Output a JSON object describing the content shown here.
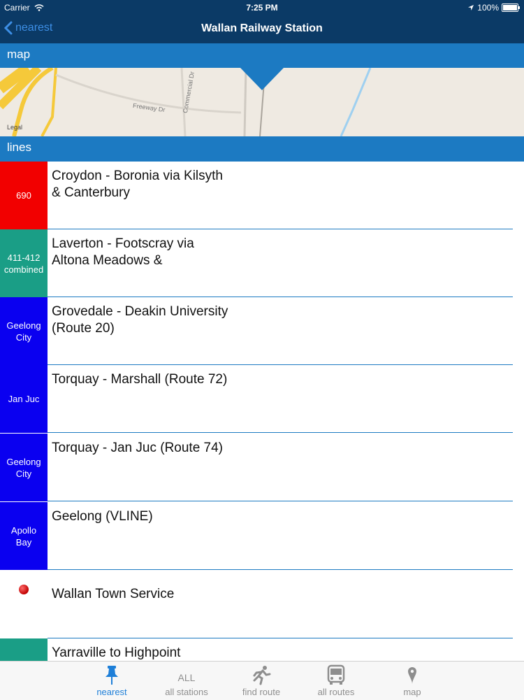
{
  "status": {
    "carrier": "Carrier",
    "time": "7:25 PM",
    "battery": "100%",
    "battery_level": 1.0
  },
  "nav": {
    "back_label": "nearest",
    "title": "Wallan Railway Station"
  },
  "sections": {
    "map": "map",
    "lines": "lines"
  },
  "map": {
    "labels": [
      "Freeway Dr",
      "Commercial Dr",
      "Legal"
    ]
  },
  "lines": [
    {
      "badge": "690",
      "name": "Croydon - Boronia via Kilsyth & Canterbury",
      "color": "#f20000"
    },
    {
      "badge": "411-412 combined",
      "name": "Laverton - Footscray via Altona Meadows &",
      "color": "#1a9e86"
    },
    {
      "badge": "Geelong City",
      "name": "Grovedale - Deakin University (Route 20)",
      "color": "#0a00f0"
    },
    {
      "badge": "Jan Juc",
      "name": "Torquay - Marshall (Route 72)",
      "color": "#0a00f0"
    },
    {
      "badge": "Geelong City",
      "name": "Torquay - Jan Juc (Route 74)",
      "color": "#0a00f0"
    },
    {
      "badge": "Apollo Bay",
      "name": "Geelong (VLINE)",
      "color": "#0a00f0"
    },
    {
      "badge": "",
      "name": "Wallan Town Service",
      "color": "#ffffff",
      "icon": "red-dot-icon"
    },
    {
      "badge": "",
      "name": "Yarraville to Highpoint",
      "color": "#1a9e86"
    }
  ],
  "tabs": [
    {
      "label": "nearest",
      "icon": "pin-icon",
      "active": true
    },
    {
      "label": "all stations",
      "icon": "all-text-icon",
      "icon_text": "ALL",
      "active": false
    },
    {
      "label": "find route",
      "icon": "runner-icon",
      "active": false
    },
    {
      "label": "all routes",
      "icon": "bus-icon",
      "active": false
    },
    {
      "label": "map",
      "icon": "map-marker-icon",
      "active": false
    }
  ],
  "colors": {
    "topbar": "#0b3a66",
    "section": "#1c7ac2",
    "tab_active": "#1e7fd8",
    "tab_inactive": "#8e8e8e"
  }
}
